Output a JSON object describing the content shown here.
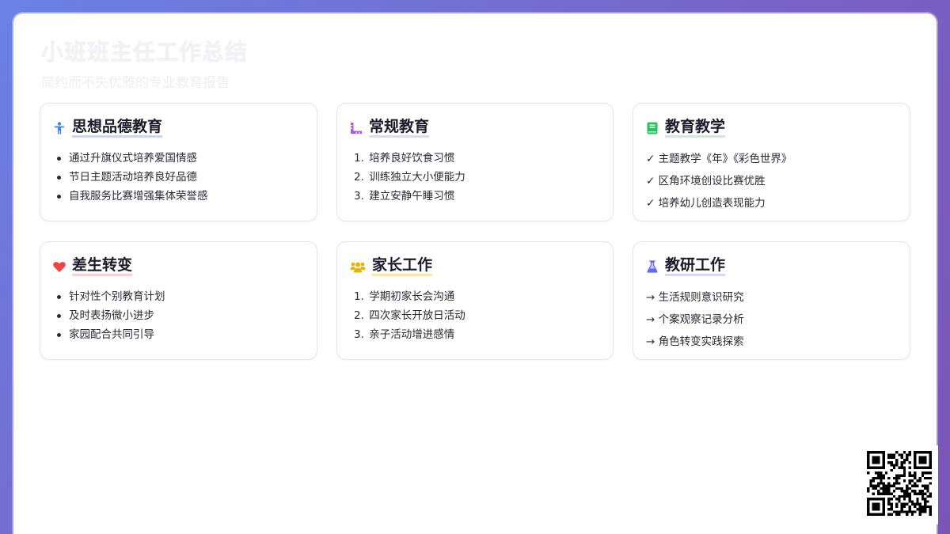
{
  "header": {
    "title": "小班班主任工作总结",
    "subtitle": "简约而不失优雅的专业教育报告"
  },
  "colors": {
    "accent_blue": "#3b82f6",
    "accent_purple": "#a855f7",
    "accent_green": "#22c55e",
    "accent_red": "#ef4444",
    "accent_yellow": "#eab308",
    "accent_indigo": "#6366f1"
  },
  "cards": [
    {
      "title": "思想品德教育",
      "icon": "child-icon",
      "items": [
        "通过升旗仪式培养爱国情感",
        "节日主题活动培养良好品德",
        "自我服务比赛增强集体荣誉感"
      ]
    },
    {
      "title": "常规教育",
      "icon": "ruler-icon",
      "items": [
        "培养良好饮食习惯",
        "训练独立大小便能力",
        "建立安静午睡习惯"
      ],
      "markers": [
        "1.",
        "2.",
        "3."
      ]
    },
    {
      "title": "教育教学",
      "icon": "book-icon",
      "items": [
        "✓ 主题教学《年》《彩色世界》",
        "✓ 区角环境创设比赛优胜",
        "✓ 培养幼儿创造表现能力"
      ]
    },
    {
      "title": "差生转变",
      "icon": "heart-icon",
      "items": [
        "针对性个别教育计划",
        "及时表扬微小进步",
        "家园配合共同引导"
      ]
    },
    {
      "title": "家长工作",
      "icon": "users-icon",
      "items": [
        "学期初家长会沟通",
        "四次家长开放日活动",
        "亲子活动增进感情"
      ],
      "markers": [
        "1.",
        "2.",
        "3."
      ]
    },
    {
      "title": "教研工作",
      "icon": "flask-icon",
      "items": [
        "→ 生活规则意识研究",
        "→ 个案观察记录分析",
        "→ 角色转变实践探索"
      ]
    }
  ]
}
